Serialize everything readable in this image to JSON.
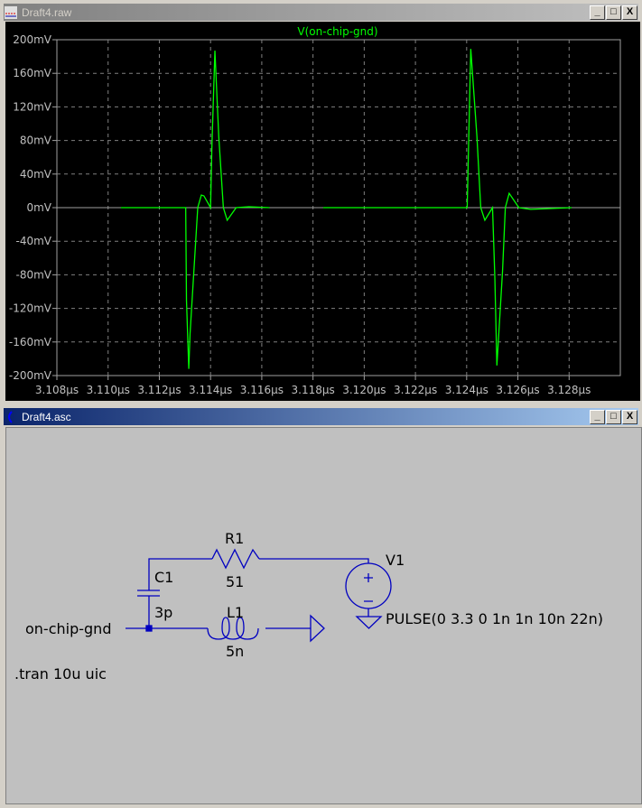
{
  "waveform_window": {
    "title": "Draft4.raw",
    "buttons": [
      "_",
      "□",
      "X"
    ]
  },
  "schematic_window": {
    "title": "Draft4.asc",
    "buttons": [
      "_",
      "□",
      "X"
    ]
  },
  "chart_data": {
    "type": "line",
    "title": "V(on-chip-gnd)",
    "xlabel": "",
    "ylabel": "",
    "xlim": [
      3.108,
      3.13
    ],
    "ylim": [
      -200,
      200
    ],
    "grid": true,
    "x_ticks": [
      "3.108µs",
      "3.110µs",
      "3.112µs",
      "3.114µs",
      "3.116µs",
      "3.118µs",
      "3.120µs",
      "3.122µs",
      "3.124µs",
      "3.126µs",
      "3.128µs"
    ],
    "x_tick_values": [
      3.108,
      3.11,
      3.112,
      3.114,
      3.116,
      3.118,
      3.12,
      3.122,
      3.124,
      3.126,
      3.128
    ],
    "y_ticks": [
      "200mV",
      "160mV",
      "120mV",
      "80mV",
      "40mV",
      "0mV",
      "-40mV",
      "-80mV",
      "-120mV",
      "-160mV",
      "-200mV"
    ],
    "y_tick_values": [
      200,
      160,
      120,
      80,
      40,
      0,
      -40,
      -80,
      -120,
      -160,
      -200
    ],
    "color": "#00ff00",
    "series": [
      {
        "name": "V(on-chip-gnd) segment 1",
        "x": [
          3.1105,
          3.11303,
          3.11306,
          3.11315,
          3.1132,
          3.1135,
          3.11364,
          3.11374,
          3.114,
          3.11405,
          3.11417,
          3.11432,
          3.1145,
          3.11465,
          3.115,
          3.1155,
          3.1163
        ],
        "y": [
          0,
          0,
          -110,
          -192,
          -150,
          0,
          15,
          14,
          0,
          70,
          187,
          85,
          0,
          -15,
          0,
          1,
          0
        ]
      },
      {
        "name": "V(on-chip-gnd) segment 2",
        "x": [
          3.1184,
          3.12402,
          3.12405,
          3.12416,
          3.1244,
          3.12455,
          3.12471,
          3.12501,
          3.1251,
          3.12518,
          3.1254,
          3.12551,
          3.12566,
          3.12604,
          3.1265,
          3.1281
        ],
        "y": [
          0,
          0,
          40,
          189,
          85,
          0,
          -15,
          0,
          -83,
          -188,
          -76,
          0,
          17,
          0,
          -2,
          0
        ]
      }
    ]
  },
  "schematic": {
    "r1": {
      "name": "R1",
      "value": "51"
    },
    "c1": {
      "name": "C1",
      "value": "3p"
    },
    "l1": {
      "name": "L1",
      "value": "5n"
    },
    "v1": {
      "name": "V1",
      "value": "PULSE(0 3.3 0 1n 1n 10n 22n)"
    },
    "net_label": "on-chip-gnd",
    "directive": ".tran 10u uic",
    "wire_color": "#0000c0"
  }
}
